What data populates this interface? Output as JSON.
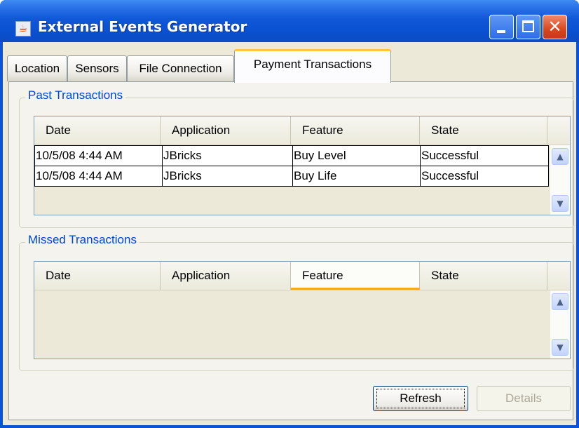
{
  "window": {
    "title": "External Events Generator",
    "app_icon": "java-coffee-cup-icon",
    "controls": [
      "minimize-icon",
      "maximize-icon",
      "close-icon"
    ]
  },
  "tabs": [
    {
      "label": "Location",
      "active": false
    },
    {
      "label": "Sensors",
      "active": false
    },
    {
      "label": "File Connection",
      "active": false
    },
    {
      "label": "Payment Transactions",
      "active": true
    }
  ],
  "past_transactions": {
    "title": "Past Transactions",
    "columns": [
      "Date",
      "Application",
      "Feature",
      "State"
    ],
    "rows": [
      [
        "10/5/08 4:44 AM",
        "JBricks",
        "Buy Level",
        "Successful"
      ],
      [
        "10/5/08 4:44 AM",
        "JBricks",
        "Buy Life",
        "Successful"
      ]
    ]
  },
  "missed_transactions": {
    "title": "Missed Transactions",
    "columns": [
      "Date",
      "Application",
      "Feature",
      "State"
    ],
    "rows": []
  },
  "buttons": {
    "refresh": "Refresh",
    "details": "Details"
  },
  "colors": {
    "titlebar": "#0a52d6",
    "group_title": "#0046d5",
    "active_tab_accent": "#ffc83c",
    "header_hover_accent": "#f8a81c"
  }
}
